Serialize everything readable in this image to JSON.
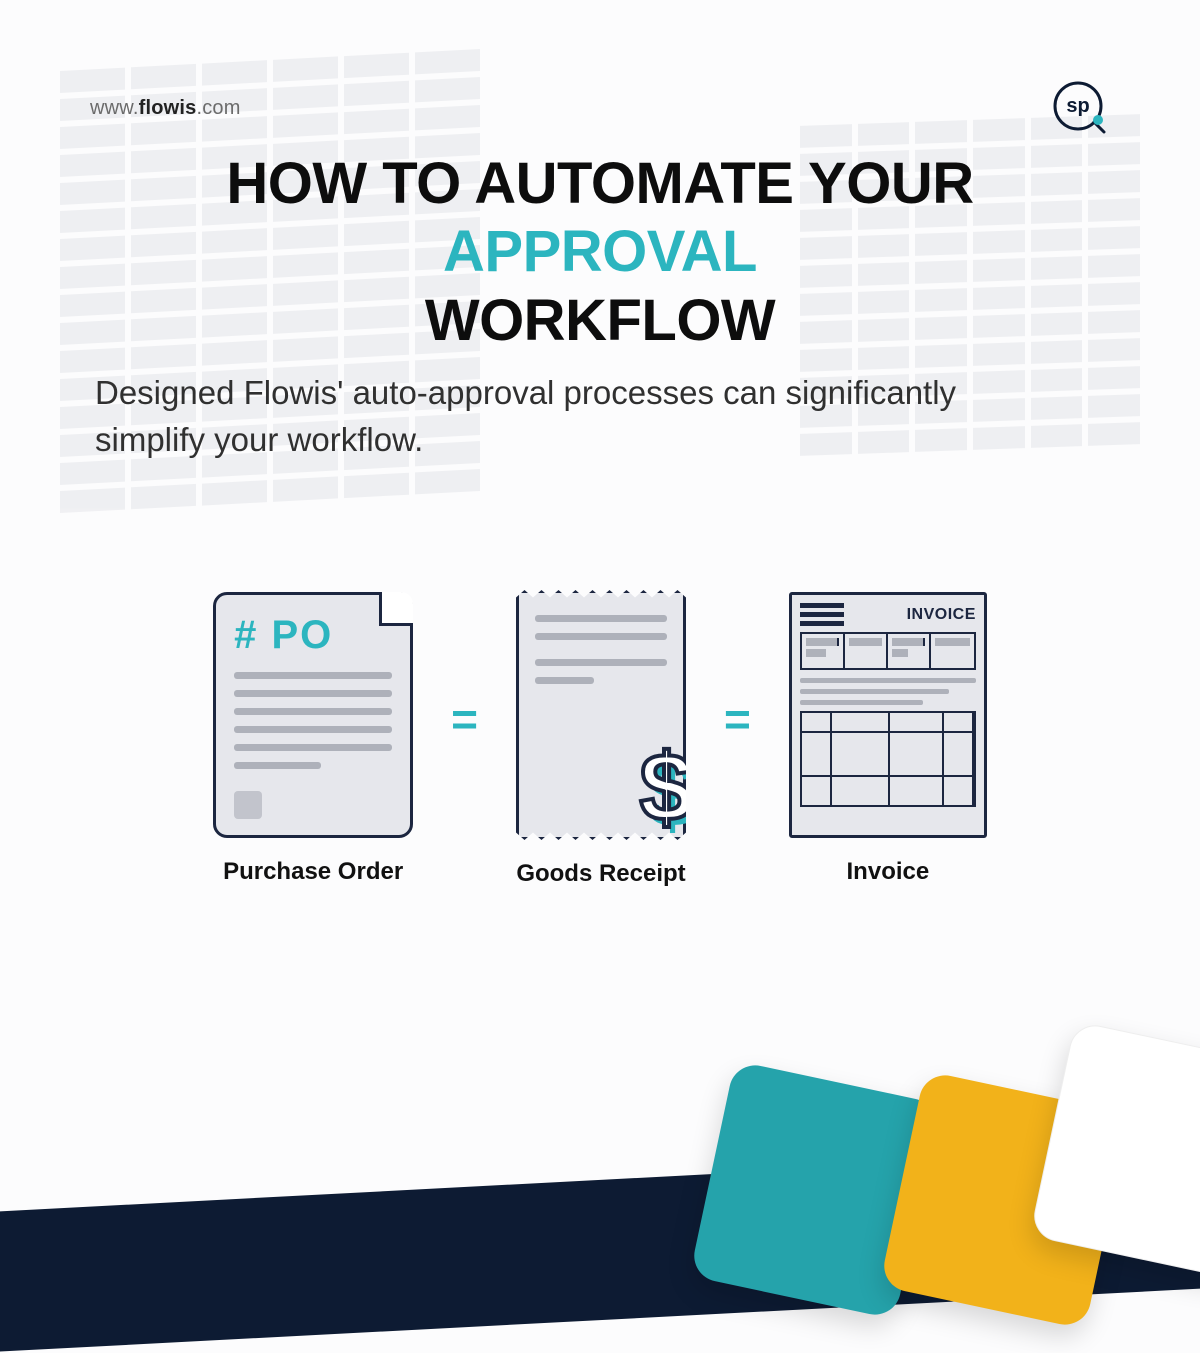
{
  "url": {
    "prefix": "www.",
    "brand": "flowis",
    "suffix": ".com"
  },
  "logo": {
    "text": "sp"
  },
  "title": {
    "line1_pre": "HOW TO AUTOMATE YOUR ",
    "line1_accent": "APPROVAL",
    "line2": "WORKFLOW"
  },
  "subhead": "Designed Flowis' auto-approval processes can significantly simplify your workflow.",
  "diagram": {
    "po": {
      "tag": "# PO",
      "label": "Purchase Order"
    },
    "equals": "=",
    "receipt": {
      "dollar": "$",
      "label": "Goods Receipt"
    },
    "invoice": {
      "header": "INVOICE",
      "label": "Invoice"
    }
  },
  "colors": {
    "accent": "#2cb5bf",
    "dark": "#1c2640",
    "yellow": "#f2b21a"
  }
}
